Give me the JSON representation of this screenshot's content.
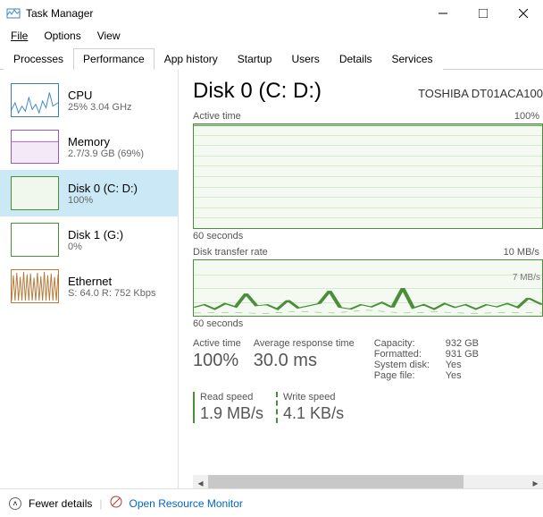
{
  "window": {
    "title": "Task Manager"
  },
  "menu": {
    "file": "File",
    "options": "Options",
    "view": "View"
  },
  "tabs": {
    "processes": "Processes",
    "performance": "Performance",
    "app_history": "App history",
    "startup": "Startup",
    "users": "Users",
    "details": "Details",
    "services": "Services"
  },
  "sidebar": {
    "items": [
      {
        "name": "CPU",
        "sub": "25% 3.04 GHz"
      },
      {
        "name": "Memory",
        "sub": "2.7/3.9 GB (69%)"
      },
      {
        "name": "Disk 0 (C: D:)",
        "sub": "100%"
      },
      {
        "name": "Disk 1 (G:)",
        "sub": "0%"
      },
      {
        "name": "Ethernet",
        "sub": "S: 64.0 R: 752 Kbps"
      }
    ]
  },
  "main": {
    "title": "Disk 0 (C: D:)",
    "model": "TOSHIBA DT01ACA100",
    "chart1": {
      "label": "Active time",
      "right": "100%",
      "xaxis": "60 seconds"
    },
    "chart2": {
      "label": "Disk transfer rate",
      "right": "10 MB/s",
      "inner": "7 MB/s",
      "xaxis": "60 seconds"
    },
    "active_time_label": "Active time",
    "active_time_value": "100%",
    "avg_resp_label": "Average response time",
    "avg_resp_value": "30.0 ms",
    "read_label": "Read speed",
    "read_value": "1.9 MB/s",
    "write_label": "Write speed",
    "write_value": "4.1 KB/s",
    "props": {
      "capacity_k": "Capacity:",
      "capacity_v": "932 GB",
      "formatted_k": "Formatted:",
      "formatted_v": "931 GB",
      "sysdisk_k": "System disk:",
      "sysdisk_v": "Yes",
      "pagefile_k": "Page file:",
      "pagefile_v": "Yes"
    }
  },
  "footer": {
    "fewer": "Fewer details",
    "resmon": "Open Resource Monitor"
  },
  "chart_data": [
    {
      "type": "line",
      "title": "Active time",
      "ylabel": "%",
      "ylim": [
        0,
        100
      ],
      "x_seconds": 60,
      "values": [
        100,
        100,
        100,
        100,
        100,
        100,
        100,
        100,
        100,
        100,
        100,
        100,
        100,
        100,
        100,
        100,
        100,
        100,
        100,
        100,
        100,
        100,
        100,
        100,
        100,
        100,
        100,
        100,
        100,
        100,
        100,
        100,
        100,
        100,
        100,
        100,
        100,
        100,
        100,
        100,
        100,
        100,
        100,
        100,
        100,
        100,
        100,
        100,
        100,
        100,
        100,
        100,
        100,
        100,
        100,
        100,
        100,
        100,
        100,
        100
      ]
    },
    {
      "type": "line",
      "title": "Disk transfer rate",
      "ylabel": "MB/s",
      "ylim": [
        0,
        10
      ],
      "x_seconds": 60,
      "series": [
        {
          "name": "Read",
          "values": [
            1.2,
            1.5,
            1.0,
            1.8,
            1.3,
            3.0,
            1.4,
            1.6,
            1.0,
            2.2,
            1.1,
            1.4,
            1.7,
            3.5,
            1.2,
            1.0,
            1.5,
            1.3,
            1.9,
            1.2,
            4.0,
            1.1,
            1.5,
            1.0,
            1.8,
            1.2,
            1.6,
            1.0,
            1.5,
            1.3,
            1.7,
            1.2,
            3.2,
            1.0,
            1.4,
            1.6,
            1.1,
            1.5,
            2.0,
            1.2,
            1.9,
            1.0,
            1.4,
            1.6,
            1.2,
            1.5,
            2.5,
            1.1,
            1.4,
            1.8,
            1.0,
            1.5,
            1.3,
            2.2,
            1.6,
            1.2,
            1.0,
            1.5,
            1.9,
            1.9
          ]
        },
        {
          "name": "Write",
          "values": [
            0.2,
            0.3,
            0.1,
            0.4,
            0.2,
            0.5,
            0.2,
            0.3,
            0.1,
            0.4,
            0.2,
            0.3,
            0.2,
            0.6,
            0.2,
            0.1,
            0.3,
            0.2,
            0.4,
            0.2,
            0.7,
            0.1,
            0.2,
            0.1,
            0.3,
            0.2,
            0.3,
            0.1,
            0.2,
            0.2,
            0.3,
            0.2,
            0.5,
            0.1,
            0.2,
            0.3,
            0.1,
            0.2,
            0.4,
            0.2,
            0.3,
            0.1,
            0.2,
            0.3,
            0.2,
            0.2,
            0.4,
            0.1,
            0.2,
            0.3,
            0.1,
            0.2,
            0.2,
            0.4,
            0.3,
            0.2,
            0.1,
            0.2,
            0.3,
            0.004
          ]
        }
      ]
    }
  ]
}
